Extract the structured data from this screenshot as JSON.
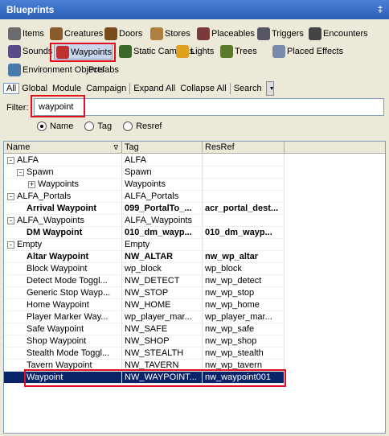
{
  "window": {
    "title": "Blueprints",
    "pin_glyph": "‡"
  },
  "categories_row1": [
    {
      "label": "Items",
      "icon": "items-icon",
      "color": "#6b6b6b"
    },
    {
      "label": "Creatures",
      "icon": "creatures-icon",
      "color": "#8a5a2a"
    },
    {
      "label": "Doors",
      "icon": "doors-icon",
      "color": "#7a4a1a"
    },
    {
      "label": "Stores",
      "icon": "stores-icon",
      "color": "#b08040"
    },
    {
      "label": "Placeables",
      "icon": "placeables-icon",
      "color": "#7a3a3a"
    },
    {
      "label": "Triggers",
      "icon": "triggers-icon",
      "color": "#556"
    },
    {
      "label": "Encounters",
      "icon": "encounters-icon",
      "color": "#444"
    }
  ],
  "categories_row2": [
    {
      "label": "Sounds",
      "icon": "sounds-icon",
      "color": "#5a4a8a"
    },
    {
      "label": "Waypoints",
      "icon": "waypoints-icon",
      "color": "#c03030"
    },
    {
      "label": "Static Cameras",
      "icon": "static-cameras-icon",
      "color": "#3a6a2a"
    },
    {
      "label": "Lights",
      "icon": "lights-icon",
      "color": "#e0a020"
    },
    {
      "label": "Trees",
      "icon": "trees-icon",
      "color": "#5a7a2a"
    },
    {
      "label": "Placed Effects",
      "icon": "placed-effects-icon",
      "color": "#7a8aaa"
    }
  ],
  "categories_row3": [
    {
      "label": "Environment Objects",
      "icon": "environment-objects-icon",
      "color": "#4a7aaa"
    },
    {
      "label": "Prefabs",
      "icon": "",
      "color": ""
    }
  ],
  "scope": [
    "All",
    "Global",
    "Module",
    "Campaign",
    "Expand All",
    "Collapse All",
    "Search"
  ],
  "filter": {
    "label": "Filter:",
    "value": "waypoint"
  },
  "search_by": {
    "options": [
      "Name",
      "Tag",
      "Resref"
    ],
    "selected": "Name"
  },
  "columns": [
    "Name",
    "Tag",
    "ResRef"
  ],
  "rows": [
    {
      "level": 0,
      "toggle": "-",
      "name": "ALFA",
      "tag": "ALFA",
      "resref": "",
      "bold": false
    },
    {
      "level": 1,
      "toggle": "-",
      "name": "Spawn",
      "tag": "Spawn",
      "resref": "",
      "bold": false
    },
    {
      "level": 2,
      "toggle": "+",
      "name": "Waypoints",
      "tag": "Waypoints",
      "resref": "",
      "bold": false
    },
    {
      "level": 0,
      "toggle": "-",
      "name": "ALFA_Portals",
      "tag": "ALFA_Portals",
      "resref": "",
      "bold": false
    },
    {
      "level": 1,
      "toggle": "",
      "name": "Arrival Waypoint",
      "tag": "099_PortalTo_...",
      "resref": "acr_portal_dest...",
      "bold": true
    },
    {
      "level": 0,
      "toggle": "-",
      "name": "ALFA_Waypoints",
      "tag": "ALFA_Waypoints",
      "resref": "",
      "bold": false
    },
    {
      "level": 1,
      "toggle": "",
      "name": "DM Waypoint",
      "tag": "010_dm_wayp...",
      "resref": "010_dm_wayp...",
      "bold": true
    },
    {
      "level": 0,
      "toggle": "-",
      "name": "Empty",
      "tag": "Empty",
      "resref": "",
      "bold": false
    },
    {
      "level": 1,
      "toggle": "",
      "name": "Altar Waypoint",
      "tag": "NW_ALTAR",
      "resref": "nw_wp_altar",
      "bold": true
    },
    {
      "level": 1,
      "toggle": "",
      "name": "Block Waypoint",
      "tag": "wp_block",
      "resref": "wp_block",
      "bold": false
    },
    {
      "level": 1,
      "toggle": "",
      "name": "Detect Mode Toggl...",
      "tag": "NW_DETECT",
      "resref": "nw_wp_detect",
      "bold": false
    },
    {
      "level": 1,
      "toggle": "",
      "name": "Generic Stop Wayp...",
      "tag": "NW_STOP",
      "resref": "nw_wp_stop",
      "bold": false
    },
    {
      "level": 1,
      "toggle": "",
      "name": "Home Waypoint",
      "tag": "NW_HOME",
      "resref": "nw_wp_home",
      "bold": false
    },
    {
      "level": 1,
      "toggle": "",
      "name": "Player Marker Way...",
      "tag": "wp_player_mar...",
      "resref": "wp_player_mar...",
      "bold": false
    },
    {
      "level": 1,
      "toggle": "",
      "name": "Safe Waypoint",
      "tag": "NW_SAFE",
      "resref": "nw_wp_safe",
      "bold": false
    },
    {
      "level": 1,
      "toggle": "",
      "name": "Shop Waypoint",
      "tag": "NW_SHOP",
      "resref": "nw_wp_shop",
      "bold": false
    },
    {
      "level": 1,
      "toggle": "",
      "name": "Stealth Mode Toggl...",
      "tag": "NW_STEALTH",
      "resref": "nw_wp_stealth",
      "bold": false
    },
    {
      "level": 1,
      "toggle": "",
      "name": "Tavern Waypoint",
      "tag": "NW_TAVERN",
      "resref": "nw_wp_tavern",
      "bold": false
    },
    {
      "level": 1,
      "toggle": "",
      "name": "Waypoint",
      "tag": "NW_WAYPOINT...",
      "resref": "nw_waypoint001",
      "bold": false,
      "selected": true
    }
  ],
  "highlight_color": "#e01020",
  "selection_color": "#0a246a"
}
